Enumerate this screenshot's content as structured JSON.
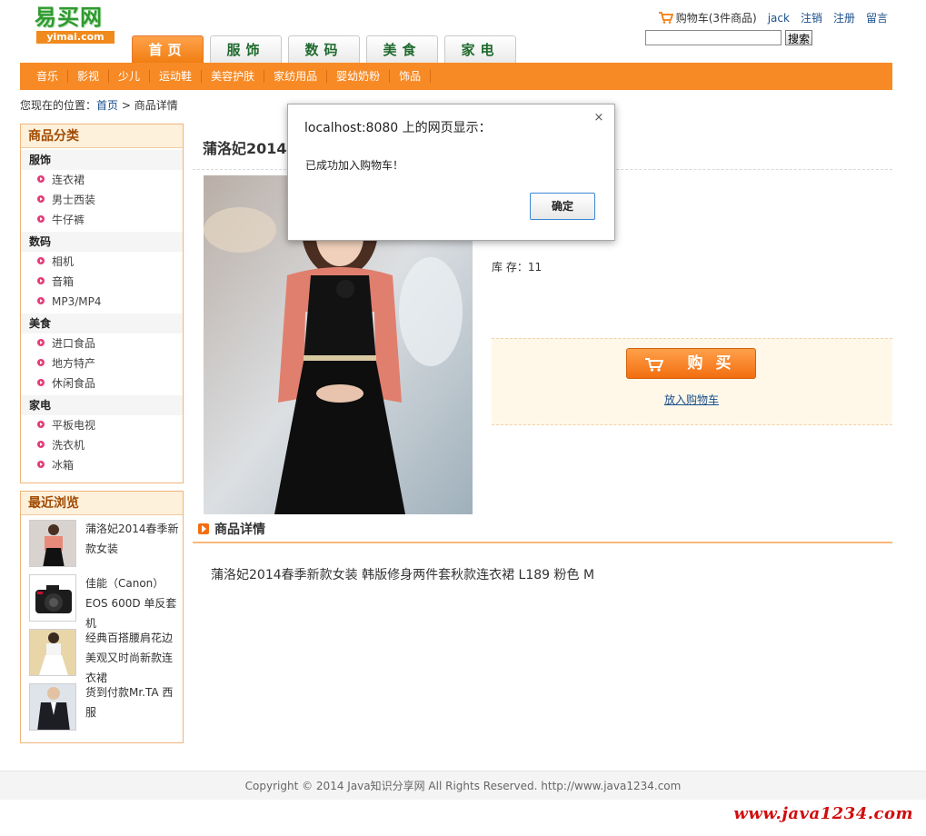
{
  "logo": {
    "title": "易买网",
    "subtitle": "yimai.com"
  },
  "top_links": {
    "cart": "购物车(3件商品)",
    "user": "jack",
    "logout": "注销",
    "register": "注册",
    "message": "留言"
  },
  "search": {
    "value": "",
    "button": "搜索"
  },
  "tabs": [
    {
      "label": "首页",
      "active": true
    },
    {
      "label": "服饰",
      "active": false
    },
    {
      "label": "数码",
      "active": false
    },
    {
      "label": "美食",
      "active": false
    },
    {
      "label": "家电",
      "active": false
    }
  ],
  "subnav": [
    "音乐",
    "影视",
    "少儿",
    "运动鞋",
    "美容护肤",
    "家纺用品",
    "婴幼奶粉",
    "饰品"
  ],
  "breadcrumb": {
    "prefix": "您现在的位置：",
    "home": "首页",
    "sep": " > ",
    "current": "商品详情"
  },
  "categories": {
    "title": "商品分类",
    "groups": [
      {
        "name": "服饰",
        "items": [
          "连衣裙",
          "男士西装",
          "牛仔裤"
        ]
      },
      {
        "name": "数码",
        "items": [
          "相机",
          "音箱",
          "MP3/MP4"
        ]
      },
      {
        "name": "美食",
        "items": [
          "进口食品",
          "地方特产",
          "休闲食品"
        ]
      },
      {
        "name": "家电",
        "items": [
          "平板电视",
          "洗衣机",
          "冰箱"
        ]
      }
    ]
  },
  "recent": {
    "title": "最近浏览",
    "items": [
      {
        "text": "蒲洛妃2014春季新款女装",
        "thumb": "dress-pink-thumb"
      },
      {
        "text": "佳能（Canon）EOS 600D 单反套机",
        "thumb": "camera-thumb"
      },
      {
        "text": "经典百搭腰肩花边美观又时尚新款连衣裙",
        "thumb": "white-dress-thumb"
      },
      {
        "text": "货到付款Mr.TA 西服",
        "thumb": "suit-thumb"
      }
    ]
  },
  "product": {
    "title": "蒲洛妃2014春季新款女装",
    "stock_label": "库 存：",
    "stock_value": "11",
    "buy_label": "购买",
    "add_cart": "放入购物车",
    "detail_title": "商品详情",
    "detail_text": "蒲洛妃2014春季新款女装 韩版修身两件套秋款连衣裙 L189 粉色 M"
  },
  "footer": {
    "copyright": "Copyright © 2014 Java知识分享网 All Rights Reserved. http://www.java1234.com"
  },
  "watermark": "www.java1234.com",
  "dialog": {
    "title": "localhost:8080 上的网页显示：",
    "message": "已成功加入购物车！",
    "ok": "确定",
    "close": "×"
  },
  "colors": {
    "accent": "#f78a25",
    "link": "#1a4f8a",
    "brand_green": "#2f9a2f",
    "watermark": "#d10d0d"
  }
}
